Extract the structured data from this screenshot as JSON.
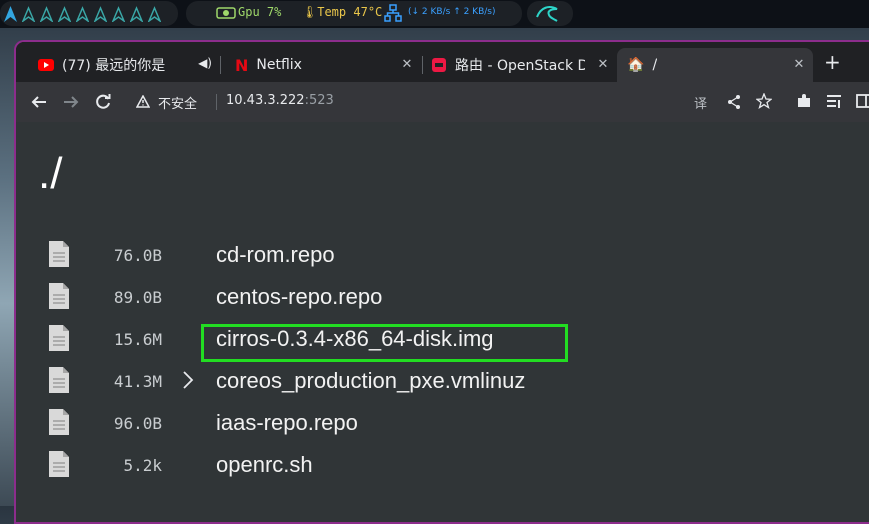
{
  "system_bar": {
    "gpu_label": "Gpu",
    "gpu_value": "7%",
    "temp_label": "Temp",
    "temp_value": "47°C",
    "net_down": "↓ 2 KB/s",
    "net_up": "↑ 2 KB/s"
  },
  "tabs": [
    {
      "title": "(77) 最远的你是",
      "icon": "youtube-icon",
      "audio": true
    },
    {
      "title": "Netflix",
      "icon": "netflix-icon"
    },
    {
      "title": "路由 - OpenStack D",
      "icon": "openstack-icon"
    },
    {
      "title": "/",
      "icon": "folder-home-icon",
      "active": true
    }
  ],
  "toolbar": {
    "insecure_label": "不安全",
    "url_host": "10.43.3.222",
    "url_port": ":523"
  },
  "page": {
    "title": "./",
    "files": [
      {
        "size": "76.0B",
        "name": "cd-rom.repo"
      },
      {
        "size": "89.0B",
        "name": "centos-repo.repo"
      },
      {
        "size": "15.6M",
        "name": "cirros-0.3.4-x86_64-disk.img",
        "highlighted": true
      },
      {
        "size": "41.3M",
        "name": "coreos_production_pxe.vmlinuz"
      },
      {
        "size": "96.0B",
        "name": "iaas-repo.repo"
      },
      {
        "size": "5.2k",
        "name": "openrc.sh"
      }
    ]
  },
  "colors": {
    "highlight": "#22dd22",
    "window_border": "#8c2d8c",
    "content_bg": "#303537"
  }
}
